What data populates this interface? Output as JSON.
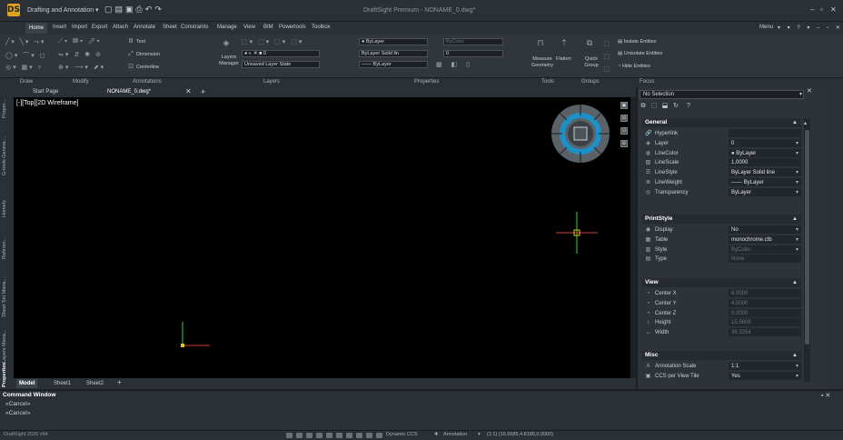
{
  "app": {
    "workspace": "Drafting and Annotation",
    "title": "DraftSight Premium - NONAME_0.dwg*",
    "menu_label": "Menu",
    "version": "DraftSight 2026 x64"
  },
  "ribbon": {
    "tabs": [
      "Home",
      "Insert",
      "Import",
      "Export",
      "Attach",
      "Annotate",
      "Sheet",
      "Constraints",
      "Manage",
      "View",
      "BIM",
      "Powertools",
      "Toolbox"
    ],
    "active_tab": "Home",
    "groups": [
      "Draw",
      "Modify",
      "Annotations",
      "Layers",
      "Properties",
      "Tools",
      "Groups",
      "Focus"
    ],
    "annotations": {
      "text": "Text",
      "dimension": "Dimension",
      "centerline": "Centerline"
    },
    "layers": {
      "manager": "Layers Manager",
      "current": "0",
      "state": "Unsaved Layer State"
    },
    "properties": {
      "color": "ByLayer",
      "color_right": "ByColor",
      "linestyle": "ByLayer Solid lin",
      "lineweight": "ByLayer",
      "transparency": "0"
    },
    "tools": {
      "measure": "Measure Geometry",
      "flatten": "Flatten"
    },
    "groups_btn": {
      "quick_group": "Quick Group"
    },
    "focus": {
      "isolate": "Isolate Entities",
      "unisolate": "Unisolate Entities",
      "hide": "Hide Entities"
    }
  },
  "document_tabs": {
    "start": "Start Page",
    "current": "NONAME_0.dwg*"
  },
  "viewport": {
    "label": "[-][Top][2D Wireframe]",
    "background": "#000000"
  },
  "sheet_tabs": [
    "Model",
    "Sheet1",
    "Sheet2"
  ],
  "command_window": {
    "title": "Command Window",
    "lines": [
      "«Cancel»",
      "«Cancel»"
    ]
  },
  "status_bar": {
    "dynamic_ccs": "Dynamic CCS",
    "annotation": "Annotation",
    "scale_coords": "(1:1) (16.6685,4.8186,0.0000)"
  },
  "properties_panel": {
    "selection": "No Selection",
    "sections": {
      "general": "General",
      "printstyle": "PrintStyle",
      "view": "View",
      "misc": "Misc"
    },
    "general": [
      {
        "icon": "hyperlink-icon",
        "label": "Hyperlink",
        "value": ""
      },
      {
        "icon": "layer-icon",
        "label": "Layer",
        "value": "0"
      },
      {
        "icon": "line-color-icon",
        "label": "LineColor",
        "value": "● ByLayer"
      },
      {
        "icon": "line-scale-icon",
        "label": "LineScale",
        "value": "1.0000"
      },
      {
        "icon": "line-style-icon",
        "label": "LineStyle",
        "value": "ByLayer    Solid line"
      },
      {
        "icon": "line-weight-icon",
        "label": "LineWeight",
        "value": "—— ByLayer"
      },
      {
        "icon": "transparency-icon",
        "label": "Transparency",
        "value": "ByLayer"
      }
    ],
    "printstyle": [
      {
        "icon": "display-icon",
        "label": "Display",
        "value": "No"
      },
      {
        "icon": "table-icon",
        "label": "Table",
        "value": "monochrome.ctb"
      },
      {
        "icon": "style-icon",
        "label": "Style",
        "value": "ByColor"
      },
      {
        "icon": "type-icon",
        "label": "Type",
        "value": "None"
      }
    ],
    "view": [
      {
        "icon": "center-x-icon",
        "label": "Center X",
        "value": "6.0000"
      },
      {
        "icon": "center-y-icon",
        "label": "Center Y",
        "value": "4.5000"
      },
      {
        "icon": "center-z-icon",
        "label": "Center Z",
        "value": "0.0000"
      },
      {
        "icon": "height-icon",
        "label": "Height",
        "value": "15.5606"
      },
      {
        "icon": "width-icon",
        "label": "Width",
        "value": "36.3254"
      }
    ],
    "misc": [
      {
        "icon": "annotation-scale-icon",
        "label": "Annotation Scale",
        "value": "1:1"
      },
      {
        "icon": "ccs-icon",
        "label": "CCS per View Tile",
        "value": "Yes"
      }
    ]
  },
  "side_tabs": [
    "Proper...",
    "G-tools Genera...",
    "Homefy",
    "Referen...",
    "Sheet Set Mana...",
    "Layers Mana...",
    "Properties"
  ],
  "colors": {
    "accent": "#1e90c8",
    "canvas": "#000000",
    "crosshair_green": "#3ecf3e",
    "crosshair_red": "#d23a3a",
    "ucs_yellow": "#e6c21a"
  }
}
